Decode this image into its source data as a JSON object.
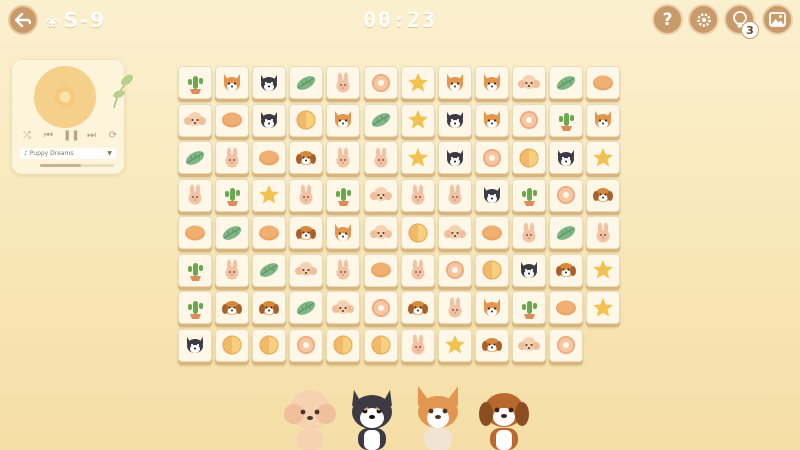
{
  "header": {
    "level_label": "S-9",
    "timer": "00:23",
    "hint_count": "3",
    "help_label": "?"
  },
  "music": {
    "song_title": "Puppy Dreams",
    "progress": 0.55
  },
  "board": {
    "rows": [
      [
        "cactus",
        "corgi",
        "husky",
        "leaf",
        "bunny",
        "donut",
        "star",
        "corgi",
        "corgi",
        "poodle",
        "leaf",
        "cookie"
      ],
      [
        "poodle",
        "cookie",
        "husky",
        "orange",
        "corgi",
        "leaf",
        "star",
        "husky",
        "corgi",
        "donut",
        "cactus",
        "corgi"
      ],
      [
        "leaf",
        "bunny",
        "cookie",
        "shiba",
        "bunny",
        "bunny",
        "star",
        "husky",
        "donut",
        "orange",
        "husky",
        "star"
      ],
      [
        "bunny",
        "cactus",
        "star",
        "bunny",
        "cactus",
        "poodle",
        "bunny",
        "bunny",
        "husky",
        "cactus",
        "donut",
        "shiba"
      ],
      [
        "cookie",
        "leaf",
        "cookie",
        "shiba",
        "corgi",
        "poodle",
        "orange",
        "poodle",
        "cookie",
        "bunny",
        "leaf",
        "bunny"
      ],
      [
        "cactus",
        "bunny",
        "leaf",
        "poodle",
        "bunny",
        "cookie",
        "bunny",
        "donut",
        "orange",
        "husky",
        "shiba",
        "star"
      ],
      [
        "cactus",
        "shiba",
        "shiba",
        "leaf",
        "poodle",
        "donut",
        "shiba",
        "bunny",
        "corgi",
        "cactus",
        "cookie",
        "star"
      ],
      [
        "husky",
        "orange",
        "orange",
        "donut",
        "orange",
        "orange",
        "bunny",
        "star",
        "shiba",
        "poodle",
        "donut",
        ""
      ]
    ]
  },
  "colors": {
    "accent": "#c99a6a",
    "tile_face": "#fff8e8",
    "background": "#f8e6b6"
  }
}
